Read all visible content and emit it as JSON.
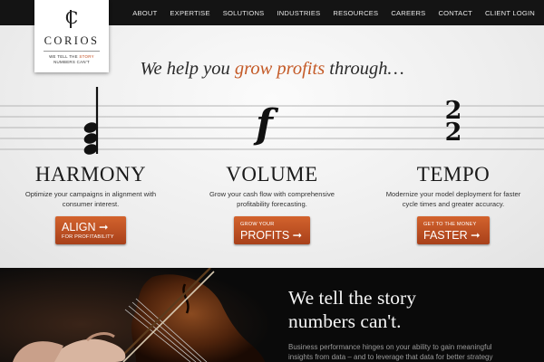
{
  "nav": {
    "items": [
      "ABOUT",
      "EXPERTISE",
      "SOLUTIONS",
      "INDUSTRIES",
      "RESOURCES",
      "CAREERS",
      "CONTACT",
      "CLIENT LOGIN"
    ]
  },
  "logo": {
    "mark": "C",
    "name": "CORIOS",
    "tagline_part1": "WE TELL THE ",
    "tagline_highlight": "STORY",
    "tagline_part2": "NUMBERS CAN'T"
  },
  "hero": {
    "headline_before": "We help you ",
    "headline_accent": "grow profits",
    "headline_after": " through…"
  },
  "pillars": [
    {
      "title": "HARMONY",
      "description": "Optimize your campaigns in alignment with consumer interest.",
      "button_big": "ALIGN ➞",
      "button_small": "FOR PROFITABILITY",
      "icon": "half-note-chord-icon"
    },
    {
      "title": "VOLUME",
      "description": "Grow your cash flow with comprehensive profitability forecasting.",
      "button_small": "GROW YOUR",
      "button_big": "PROFITS ➞",
      "icon": "forte-icon"
    },
    {
      "title": "TEMPO",
      "description": "Modernize your model deployment for faster cycle times and greater accuracy.",
      "button_small": "GET TO THE MONEY",
      "button_big": "FASTER ➞",
      "icon": "time-signature-icon",
      "time_signature_top": "2",
      "time_signature_bottom": "2"
    }
  ],
  "story": {
    "title_line1": "We tell the story",
    "title_line2": "numbers can't.",
    "text": "Business performance hinges on your ability to gain meaningful insights from data – and to leverage that data for better strategy"
  },
  "colors": {
    "accent": "#c45a27",
    "button": "#b94a20",
    "topbar": "#141414",
    "dark_panel": "#0a0a0a"
  }
}
